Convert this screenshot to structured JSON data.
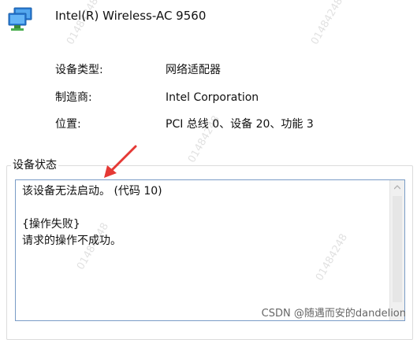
{
  "device": {
    "name": "Intel(R) Wireless-AC 9560",
    "icon": "network-adapter-icon"
  },
  "info": {
    "rows": [
      {
        "label": "设备类型:",
        "value": "网络适配器"
      },
      {
        "label": "制造商:",
        "value": "Intel Corporation"
      },
      {
        "label": "位置:",
        "value": "PCI 总线 0、设备 20、功能 3"
      }
    ]
  },
  "status": {
    "group_title": "设备状态",
    "text": "该设备无法启动。 (代码 10)\n\n{操作失败}\n请求的操作不成功。"
  },
  "watermark": {
    "text": "01484248"
  },
  "credit": {
    "text": "CSDN @随遇而安的dandelion"
  },
  "colors": {
    "textbox_border": "#7a9cc6",
    "annotation_arrow": "#e53935"
  }
}
